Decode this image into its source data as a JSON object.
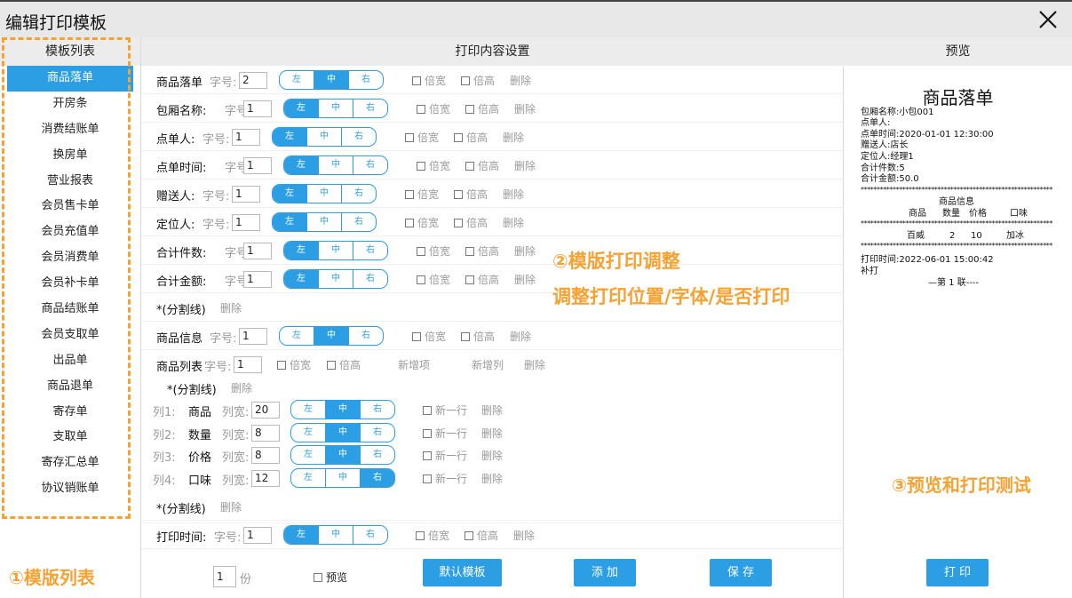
{
  "window": {
    "title": "编辑打印模板"
  },
  "left": {
    "header": "模板列表",
    "items": [
      "商品落单",
      "开房条",
      "消费结账单",
      "换房单",
      "营业报表",
      "会员售卡单",
      "会员充值单",
      "会员消费单",
      "会员补卡单",
      "商品结账单",
      "会员支取单",
      "出品单",
      "商品退单",
      "寄存单",
      "支取单",
      "寄存汇总单",
      "协议销账单"
    ],
    "annotation": "①模版列表"
  },
  "center": {
    "header": "打印内容设置",
    "font_label": "字号:",
    "align": [
      "左",
      "中",
      "右"
    ],
    "double_width": "倍宽",
    "double_height": "倍高",
    "delete": "删除",
    "separator": "*(分割线)",
    "fields": [
      {
        "name": "商品落单",
        "size": "2"
      },
      {
        "name": "包厢名称:",
        "size": "1"
      },
      {
        "name": "点单人:",
        "size": "1"
      },
      {
        "name": "点单时间:",
        "size": "1"
      },
      {
        "name": "赠送人:",
        "size": "1"
      },
      {
        "name": "定位人:",
        "size": "1"
      },
      {
        "name": "合计件数:",
        "size": "1"
      },
      {
        "name": "合计金额:",
        "size": "1"
      }
    ],
    "goods_info": {
      "name": "商品信息",
      "size": "1"
    },
    "goods_list": {
      "name": "商品列表",
      "size": "1",
      "add_item": "新增项",
      "add_column": "新增列"
    },
    "col_width_label": "列宽:",
    "new_line": "新一行",
    "columns": [
      {
        "index": "列1:",
        "name": "商品",
        "width": "20"
      },
      {
        "index": "列2:",
        "name": "数量",
        "width": "8"
      },
      {
        "index": "列3:",
        "name": "价格",
        "width": "8"
      },
      {
        "index": "列4:",
        "name": "口味",
        "width": "12"
      }
    ],
    "print_time": {
      "name": "打印时间:",
      "size": "1"
    },
    "annotation_line1": "②模版打印调整",
    "annotation_line2": "调整打印位置/字体/是否打印",
    "footer": {
      "copies": "1",
      "copies_unit": "份",
      "preview_label": "预览",
      "default_template": "默认模板",
      "add": "添 加",
      "save": "保 存"
    }
  },
  "preview": {
    "header": "预览",
    "title": "商品落单",
    "lines_top": [
      "包厢名称:小包001",
      "点单人:",
      "点单时间:2020-01-01 12:30:00",
      "赠送人:店长",
      "定位人:经理1",
      "合计件数:5",
      "合计金额:50.0"
    ],
    "stars": "******************************************************************",
    "goods_info": "商品信息",
    "table_header": [
      "商品",
      "数量",
      "价格",
      "口味"
    ],
    "table_row": [
      "百威",
      "2",
      "10",
      "加冰"
    ],
    "print_time": "打印时间:2022-06-01 15:00:42",
    "reprint": "补打",
    "copy_no": "—第 1 联----",
    "print_button": "打 印",
    "annotation": "③预览和打印测试"
  }
}
